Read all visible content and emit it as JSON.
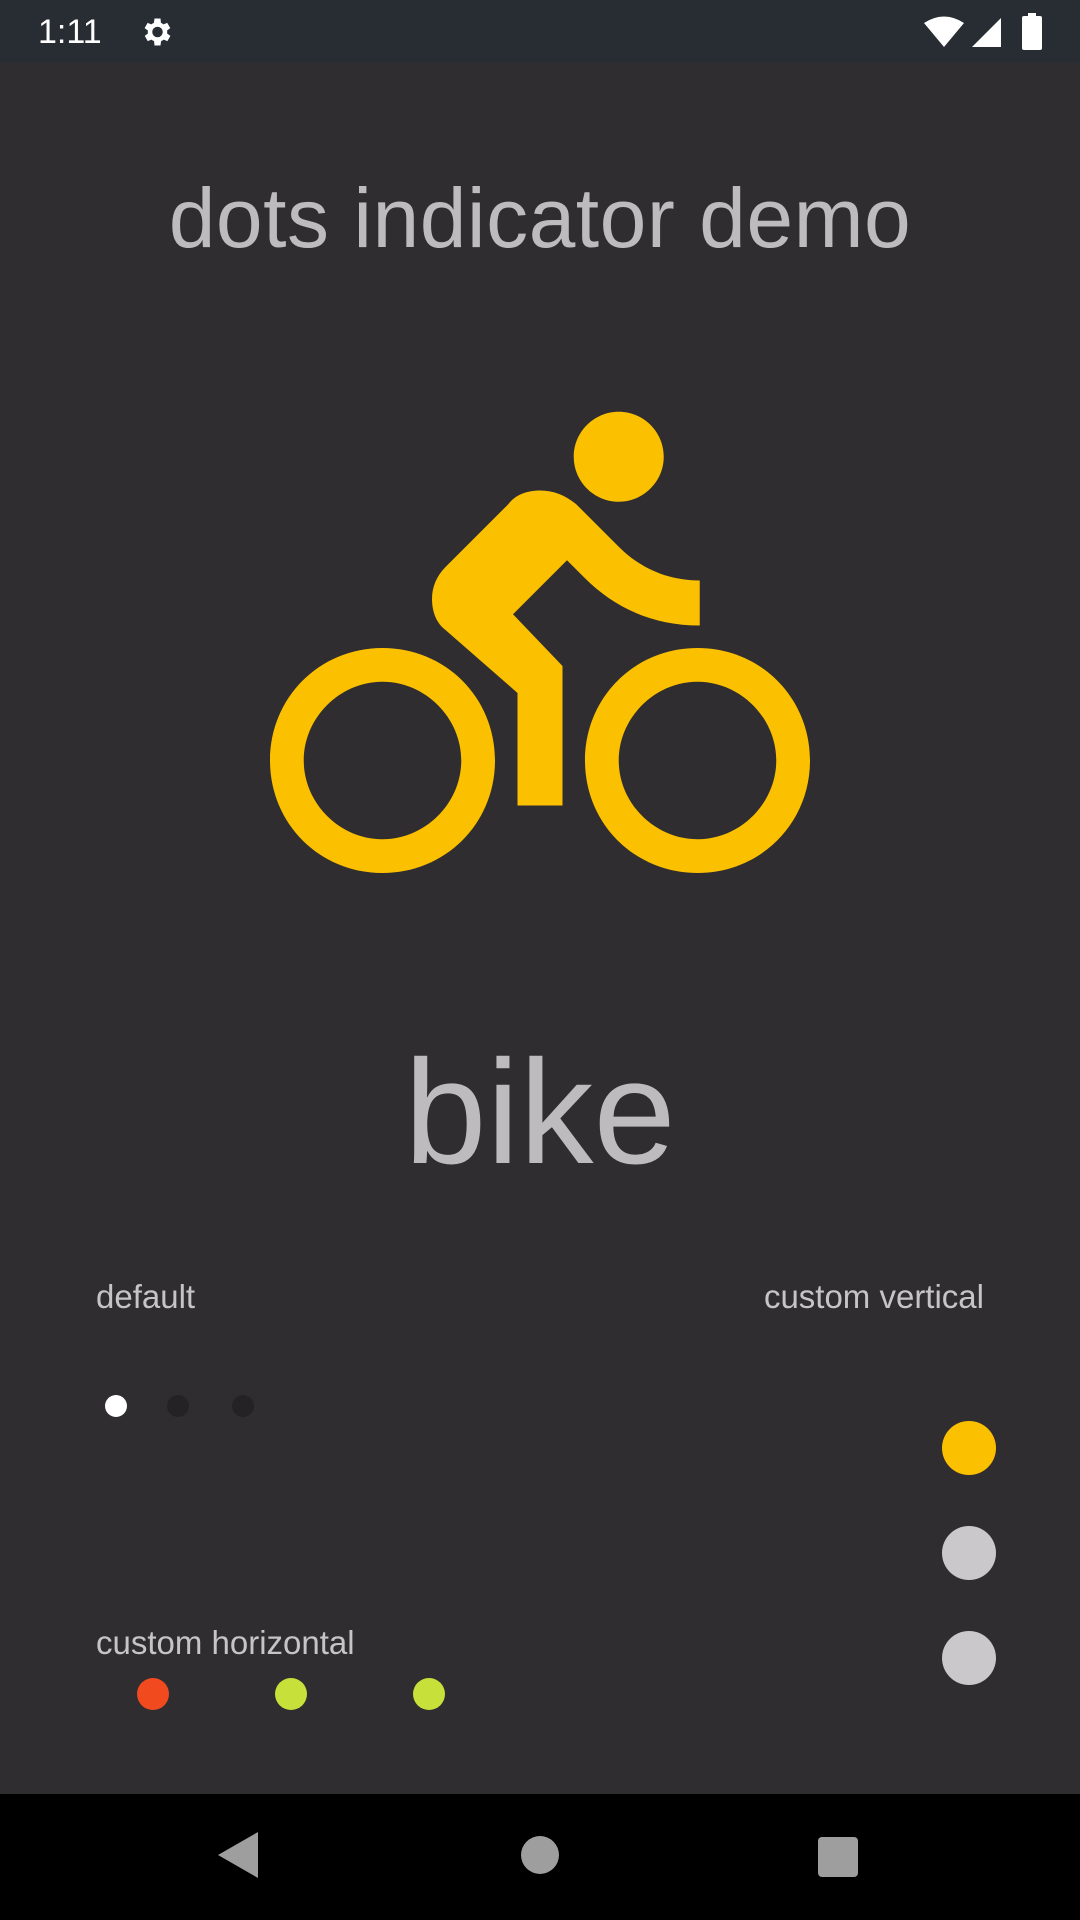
{
  "status_bar": {
    "time": "1:11",
    "icons": [
      "gear-icon",
      "wifi-icon",
      "signal-icon",
      "battery-icon"
    ]
  },
  "app": {
    "title": "dots indicator demo",
    "page_label": "bike",
    "page_icon": "bike-icon",
    "accent_color": "#fbc000"
  },
  "indicators": {
    "default": {
      "label": "default",
      "count": 3,
      "selected_index": 0,
      "selected_color": "#ffffff",
      "unselected_color": "#242224"
    },
    "custom_vertical": {
      "label": "custom vertical",
      "count": 3,
      "selected_index": 0,
      "selected_color": "#fbc000",
      "unselected_color": "#cbc8cb"
    },
    "custom_horizontal": {
      "label": "custom horizontal",
      "count": 3,
      "selected_index": 0,
      "selected_color": "#f04a1e",
      "unselected_color": "#c7e13a"
    }
  },
  "nav_bar": {
    "icons": [
      "back-icon",
      "home-icon",
      "recents-icon"
    ]
  }
}
